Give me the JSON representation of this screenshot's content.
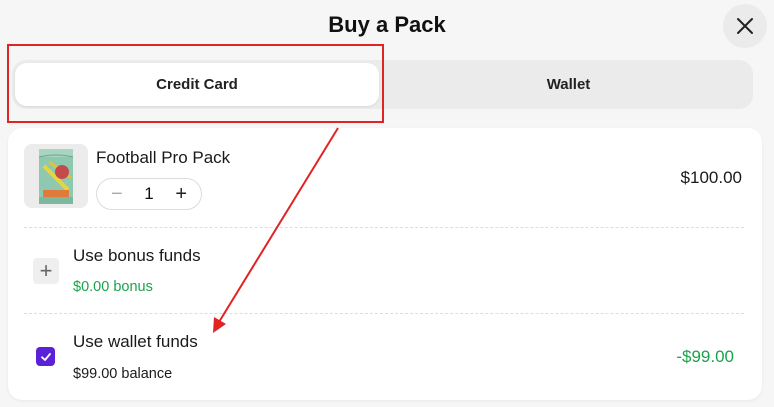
{
  "header": {
    "title": "Buy a Pack",
    "close_icon": "close-icon"
  },
  "tabs": [
    {
      "label": "Credit Card",
      "active": true
    },
    {
      "label": "Wallet",
      "active": false
    }
  ],
  "product": {
    "name": "Football Pro Pack",
    "quantity": "1",
    "minus_symbol": "−",
    "plus_symbol": "+",
    "price": "$100.00",
    "thumbnail_icon": "football-pack-image"
  },
  "bonus": {
    "label": "Use bonus funds",
    "amount": "$0.00 bonus",
    "expand_symbol": "+",
    "checked": false
  },
  "wallet": {
    "label": "Use wallet funds",
    "balance": "$99.00 balance",
    "amount": "-$99.00",
    "checked": true
  },
  "colors": {
    "accent_purple": "#5b21d9",
    "positive_green": "#1aa34a",
    "annotation_red": "#e02424"
  }
}
